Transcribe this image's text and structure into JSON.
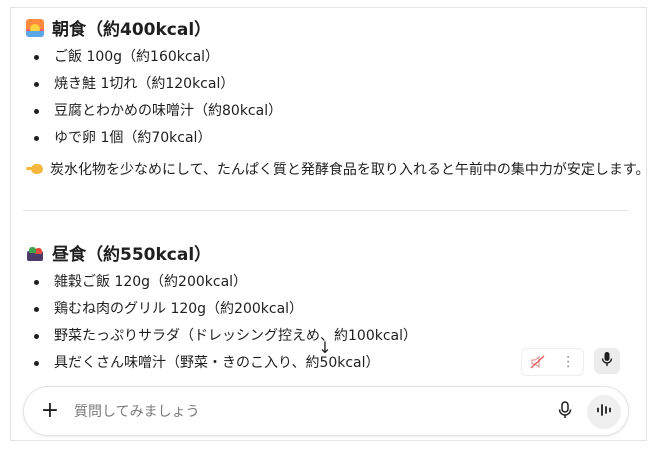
{
  "breakfast": {
    "icon": "sunrise-icon",
    "title": "朝食（約400kcal）",
    "items": [
      "ご飯 100g（約160kcal）",
      "焼き鮭 1切れ（約120kcal）",
      "豆腐とわかめの味噌汁（約80kcal）",
      "ゆで卵 1個（約70kcal）"
    ],
    "tip_icon": "pointing-hand-icon",
    "tip": "炭水化物を少なめにして、たんぱく質と発酵食品を取り入れると午前中の集中力が安定します。"
  },
  "lunch": {
    "icon": "bento-icon",
    "title": "昼食（約550kcal）",
    "items": [
      "雑穀ご飯 120g（約200kcal）",
      "鶏むね肉のグリル 120g（約200kcal）",
      "野菜たっぷりサラダ（ドレッシング控えめ、約100kcal）",
      "具だくさん味噌汁（野菜・きのこ入り、約50kcal）"
    ]
  },
  "controls": {
    "scroll_down_icon": "arrow-down-icon",
    "speaker_icon": "speaker-muted-icon",
    "more_icon": "more-vertical-icon",
    "mic_chip_icon": "mic-icon"
  },
  "composer": {
    "placeholder": "質問してみましょう",
    "value": "",
    "plus_icon": "plus-icon",
    "mic_icon": "mic-icon",
    "voice_icon": "voice-waveform-icon"
  }
}
